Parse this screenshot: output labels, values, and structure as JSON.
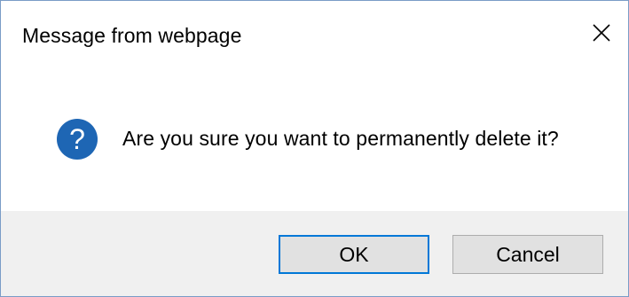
{
  "dialog": {
    "title": "Message from webpage",
    "message": "Are you sure you want to permanently delete it?",
    "icon": "question-icon",
    "buttons": {
      "ok_label": "OK",
      "cancel_label": "Cancel"
    }
  },
  "colors": {
    "accent": "#0078d7",
    "icon_fill": "#1e66b4",
    "button_bar_bg": "#f0f0f0",
    "button_bg": "#e1e1e1"
  }
}
